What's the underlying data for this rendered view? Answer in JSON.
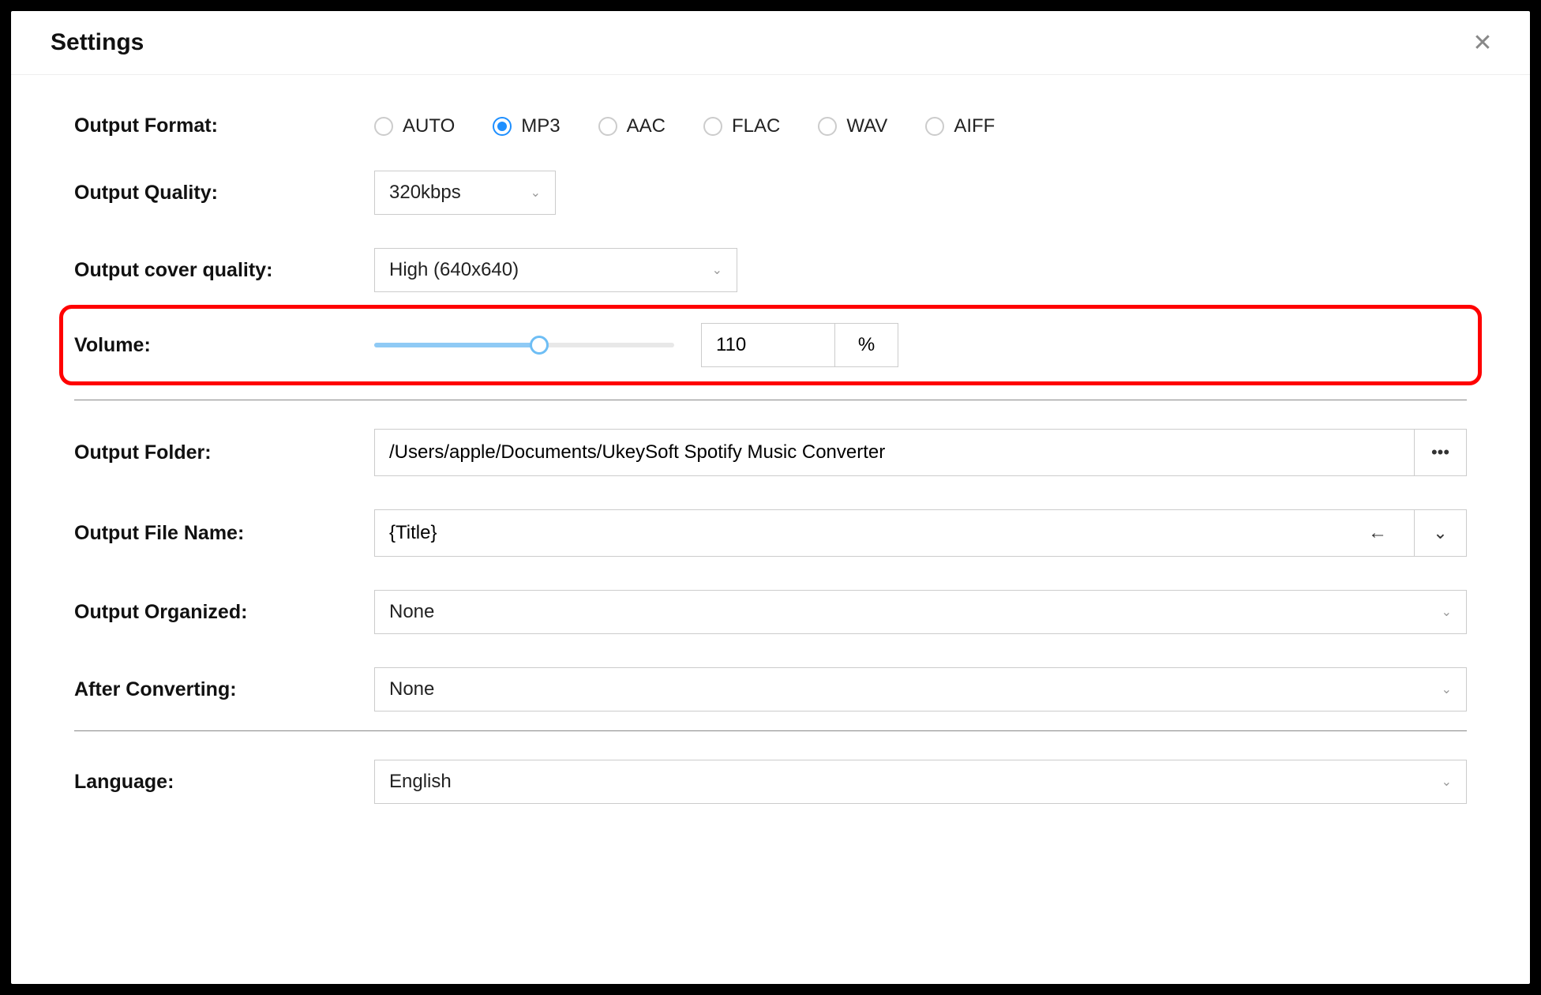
{
  "title": "Settings",
  "labels": {
    "output_format": "Output Format:",
    "output_quality": "Output Quality:",
    "output_cover_quality": "Output cover quality:",
    "volume": "Volume:",
    "output_folder": "Output Folder:",
    "output_file_name": "Output File Name:",
    "output_organized": "Output Organized:",
    "after_converting": "After Converting:",
    "language": "Language:"
  },
  "output_format": {
    "selected": "MP3",
    "options": [
      "AUTO",
      "MP3",
      "AAC",
      "FLAC",
      "WAV",
      "AIFF"
    ]
  },
  "output_quality": {
    "value": "320kbps"
  },
  "output_cover_quality": {
    "value": "High (640x640)"
  },
  "volume": {
    "value": "110",
    "unit": "%",
    "percent": 55
  },
  "output_folder": {
    "value": "/Users/apple/Documents/UkeySoft Spotify Music Converter"
  },
  "output_file_name": {
    "value": "{Title}"
  },
  "output_organized": {
    "value": "None"
  },
  "after_converting": {
    "value": "None"
  },
  "language": {
    "value": "English"
  },
  "icons": {
    "close": "✕",
    "chevron_down": "⌄",
    "more": "•••",
    "reset": "←"
  }
}
